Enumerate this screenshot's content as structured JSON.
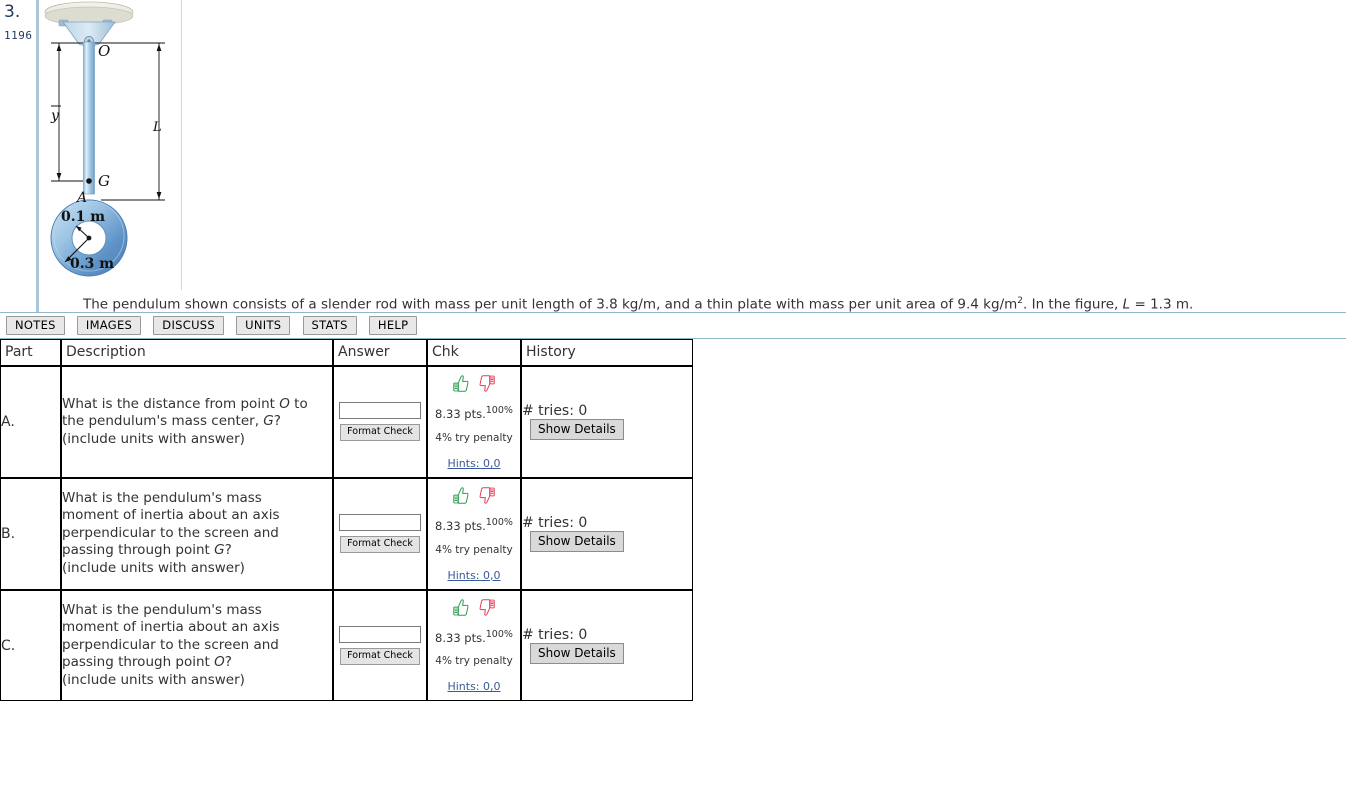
{
  "problem": {
    "number": "3.",
    "id": "1196",
    "statement_parts": {
      "before_sup": "The pendulum shown consists of a slender rod with mass per unit length of 3.8 kg/m, and a thin plate with mass per unit area of 9.4 kg/m",
      "sup": "2",
      "after_sup": ". In the figure, ",
      "var_L": "L",
      "tail": " = 1.3 m."
    }
  },
  "figure": {
    "name": "pendulum-diagram",
    "labels": {
      "point_O": "O",
      "point_G": "G",
      "point_A": "A",
      "dim_ybar": "y",
      "dim_L": "L",
      "inner_radius": "0.1 m",
      "outer_radius": "0.3 m"
    },
    "colors": {
      "rod": "#9cc3e0",
      "rod_light": "#d6e8f5",
      "disk_outer": "#5b8fc9",
      "disk_light": "#cfe3f4",
      "bracket": "#b8d4e8",
      "ceiling": "#e8e8e0"
    }
  },
  "toolbar": {
    "buttons": [
      {
        "label": "NOTES",
        "name": "notes-button"
      },
      {
        "label": "IMAGES",
        "name": "images-button"
      },
      {
        "label": "DISCUSS",
        "name": "discuss-button"
      },
      {
        "label": "UNITS",
        "name": "units-button"
      },
      {
        "label": "STATS",
        "name": "stats-button"
      },
      {
        "label": "HELP",
        "name": "help-button"
      }
    ]
  },
  "table": {
    "headers": {
      "part": "Part",
      "description": "Description",
      "answer": "Answer",
      "chk": "Chk",
      "history": "History"
    },
    "rows": [
      {
        "part": "A.",
        "description_lines": [
          "What is the distance from point O to",
          "the pendulum's mass center, G?",
          "(include units with answer)"
        ],
        "answer_value": "",
        "answer_placeholder": "",
        "format_check_label": "Format Check",
        "points": "8.33 pts.",
        "percent": "100%",
        "penalty": "4% try penalty",
        "hints": "Hints: 0,0",
        "tries": "# tries: 0",
        "details_label": "Show Details"
      },
      {
        "part": "B.",
        "description_lines": [
          "What is the pendulum's mass",
          "moment of inertia about an axis",
          "perpendicular to the screen and",
          "passing through point G?",
          "(include units with answer)"
        ],
        "answer_value": "",
        "answer_placeholder": "",
        "format_check_label": "Format Check",
        "points": "8.33 pts.",
        "percent": "100%",
        "penalty": "4% try penalty",
        "hints": "Hints: 0,0",
        "tries": "# tries: 0",
        "details_label": "Show Details"
      },
      {
        "part": "C.",
        "description_lines": [
          "What is the pendulum's mass",
          "moment of inertia about an axis",
          "perpendicular to the screen and",
          "passing through point O?",
          "(include units with answer)"
        ],
        "answer_value": "",
        "answer_placeholder": "",
        "format_check_label": "Format Check",
        "points": "8.33 pts.",
        "percent": "100%",
        "penalty": "4% try penalty",
        "hints": "Hints: 0,0",
        "tries": "# tries: 0",
        "details_label": "Show Details"
      }
    ]
  },
  "icons": {
    "thumb_up": "thumbs-up-icon",
    "thumb_down": "thumbs-down-icon"
  },
  "colors": {
    "thumb_up": "#2e9b4e",
    "thumb_down": "#e0405a",
    "link": "#3b5a9a",
    "rule": "#8fb8c8",
    "problem_number": "#1f3864"
  }
}
